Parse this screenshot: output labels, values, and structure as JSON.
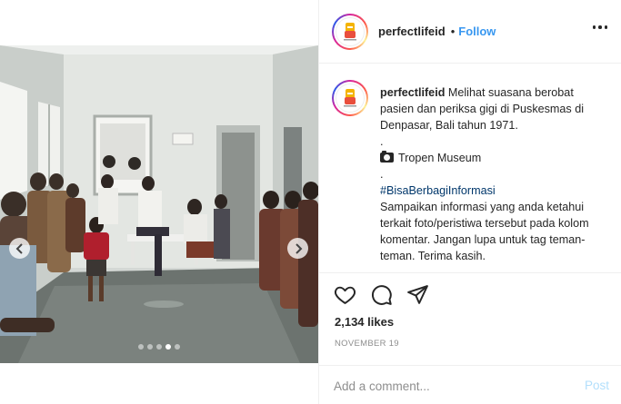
{
  "post": {
    "username": "perfectlifeid",
    "follow_label": "Follow",
    "separator": "•",
    "caption": {
      "username": "perfectlifeid",
      "text_line1": "Melihat suasana berobat pasien dan periksa gigi di Puskesmas di Denpasar, Bali tahun 1971.",
      "dot1": ".",
      "credit": "Tropen Museum",
      "dot2": ".",
      "hashtag": "#BisaBerbagiInformasi",
      "body": "Sampaikan informasi yang anda ketahui terkait foto/peristiwa tersebut pada kolom komentar. Jangan lupa untuk tag teman-teman. Terima kasih."
    },
    "likes": "2,134 likes",
    "date": "NOVEMBER 19",
    "comment_placeholder": "Add a comment...",
    "post_label": "Post"
  },
  "carousel": {
    "slide_count": 5,
    "active_index": 3
  },
  "icons": {
    "like": "heart-icon",
    "comment": "comment-icon",
    "share": "share-icon",
    "more": "more-options-icon",
    "camera": "camera-icon",
    "prev": "chevron-left-icon",
    "next": "chevron-right-icon"
  },
  "colors": {
    "accent": "#3897f0",
    "hashtag": "#00376b",
    "post_disabled": "#b2dffc",
    "muted": "#8e8e8e"
  }
}
